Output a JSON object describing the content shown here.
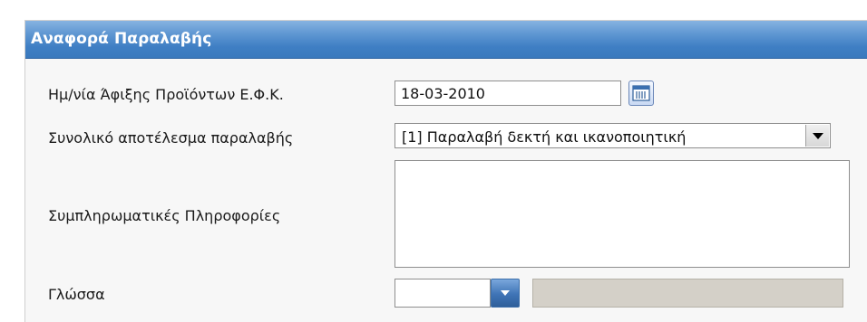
{
  "section": {
    "title": "Αναφορά Παραλαβής"
  },
  "form": {
    "arrival_date": {
      "label": "Ημ/νία Άφιξης Προϊόντων Ε.Φ.Κ.",
      "value": "18-03-2010",
      "calendar_icon": "calendar-icon"
    },
    "overall_result": {
      "label": "Συνολικό αποτέλεσμα παραλαβής",
      "selected": "[1] Παραλαβή δεκτή και ικανοποιητική"
    },
    "additional_info": {
      "label": "Συμπληρωματικές Πληροφορίες",
      "value": ""
    },
    "language": {
      "label": "Γλώσσα",
      "value": "",
      "description": ""
    }
  },
  "colors": {
    "header_blue": "#3f7fc4",
    "panel_bg": "#f7f7f7",
    "readonly_bg": "#d4d0c8"
  }
}
